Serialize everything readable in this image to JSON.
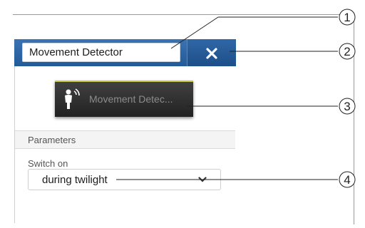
{
  "panel": {
    "name_value": "Movement Detector",
    "close_icon": "close-icon"
  },
  "tile": {
    "icon": "movement-detector-icon",
    "label": "Movement Detec..."
  },
  "parameters": {
    "section_title": "Parameters",
    "switch_on_label": "Switch on",
    "switch_on_value": "during twilight",
    "dropdown_icon": "chevron-down-icon"
  },
  "callouts": [
    "1",
    "2",
    "3",
    "4"
  ],
  "colors": {
    "header_blue": "#2f67a6",
    "tile_dark": "#333333",
    "tile_accent": "#c9c93a"
  }
}
